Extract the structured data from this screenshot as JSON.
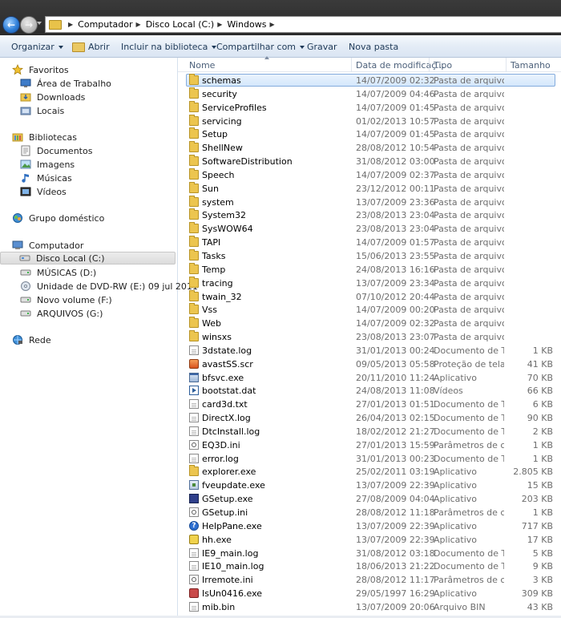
{
  "address": {
    "segments": [
      "Computador",
      "Disco Local (C:)",
      "Windows"
    ]
  },
  "toolbar": {
    "organize": "Organizar",
    "open": "Abrir",
    "include": "Incluir na biblioteca",
    "share": "Compartilhar com",
    "burn": "Gravar",
    "new_folder": "Nova pasta"
  },
  "nav": {
    "favorites": "Favoritos",
    "desktop": "Área de Trabalho",
    "downloads": "Downloads",
    "places": "Locais",
    "libraries": "Bibliotecas",
    "documents": "Documentos",
    "images": "Imagens",
    "music": "Músicas",
    "videos": "Vídeos",
    "homegroup": "Grupo doméstico",
    "computer": "Computador",
    "local_disk": "Disco Local (C:)",
    "music_drive": "MÚSICAS (D:)",
    "dvd": "Unidade de DVD-RW (E:) 09 jul 2011",
    "new_volume": "Novo volume (F:)",
    "archives": "ARQUIVOS (G:)",
    "network": "Rede"
  },
  "columns": {
    "name": "Nome",
    "date": "Data de modificaç...",
    "type": "Tipo",
    "size": "Tamanho"
  },
  "files": [
    {
      "name": "schemas",
      "date": "14/07/2009 02:32",
      "type": "Pasta de arquivos",
      "size": "",
      "icon": "folder-icon"
    },
    {
      "name": "security",
      "date": "14/07/2009 04:46",
      "type": "Pasta de arquivos",
      "size": "",
      "icon": "folder-icon"
    },
    {
      "name": "ServiceProfiles",
      "date": "14/07/2009 01:45",
      "type": "Pasta de arquivos",
      "size": "",
      "icon": "folder-icon"
    },
    {
      "name": "servicing",
      "date": "01/02/2013 10:57",
      "type": "Pasta de arquivos",
      "size": "",
      "icon": "folder-icon"
    },
    {
      "name": "Setup",
      "date": "14/07/2009 01:45",
      "type": "Pasta de arquivos",
      "size": "",
      "icon": "folder-icon"
    },
    {
      "name": "ShellNew",
      "date": "28/08/2012 10:54",
      "type": "Pasta de arquivos",
      "size": "",
      "icon": "folder-icon"
    },
    {
      "name": "SoftwareDistribution",
      "date": "31/08/2012 03:00",
      "type": "Pasta de arquivos",
      "size": "",
      "icon": "folder-icon"
    },
    {
      "name": "Speech",
      "date": "14/07/2009 02:37",
      "type": "Pasta de arquivos",
      "size": "",
      "icon": "folder-icon"
    },
    {
      "name": "Sun",
      "date": "23/12/2012 00:11",
      "type": "Pasta de arquivos",
      "size": "",
      "icon": "folder-icon"
    },
    {
      "name": "system",
      "date": "13/07/2009 23:36",
      "type": "Pasta de arquivos",
      "size": "",
      "icon": "folder-icon"
    },
    {
      "name": "System32",
      "date": "23/08/2013 23:04",
      "type": "Pasta de arquivos",
      "size": "",
      "icon": "folder-icon"
    },
    {
      "name": "SysWOW64",
      "date": "23/08/2013 23:04",
      "type": "Pasta de arquivos",
      "size": "",
      "icon": "folder-icon"
    },
    {
      "name": "TAPI",
      "date": "14/07/2009 01:57",
      "type": "Pasta de arquivos",
      "size": "",
      "icon": "folder-icon"
    },
    {
      "name": "Tasks",
      "date": "15/06/2013 23:55",
      "type": "Pasta de arquivos",
      "size": "",
      "icon": "folder-icon"
    },
    {
      "name": "Temp",
      "date": "24/08/2013 16:16",
      "type": "Pasta de arquivos",
      "size": "",
      "icon": "folder-icon"
    },
    {
      "name": "tracing",
      "date": "13/07/2009 23:34",
      "type": "Pasta de arquivos",
      "size": "",
      "icon": "folder-icon"
    },
    {
      "name": "twain_32",
      "date": "07/10/2012 20:44",
      "type": "Pasta de arquivos",
      "size": "",
      "icon": "folder-icon"
    },
    {
      "name": "Vss",
      "date": "14/07/2009 00:20",
      "type": "Pasta de arquivos",
      "size": "",
      "icon": "folder-icon"
    },
    {
      "name": "Web",
      "date": "14/07/2009 02:32",
      "type": "Pasta de arquivos",
      "size": "",
      "icon": "folder-icon"
    },
    {
      "name": "winsxs",
      "date": "23/08/2013 23:07",
      "type": "Pasta de arquivos",
      "size": "",
      "icon": "folder-icon"
    },
    {
      "name": "3dstate.log",
      "date": "31/01/2013 00:24",
      "type": "Documento de Te...",
      "size": "1 KB",
      "icon": "text-file-icon"
    },
    {
      "name": "avastSS.scr",
      "date": "09/05/2013 05:58",
      "type": "Proteção de tela",
      "size": "41 KB",
      "icon": "screensaver-icon"
    },
    {
      "name": "bfsvc.exe",
      "date": "20/11/2010 11:24",
      "type": "Aplicativo",
      "size": "70 KB",
      "icon": "application-icon"
    },
    {
      "name": "bootstat.dat",
      "date": "24/08/2013 11:08",
      "type": "Vídeos",
      "size": "66 KB",
      "icon": "video-file-icon"
    },
    {
      "name": "card3d.txt",
      "date": "27/01/2013 01:51",
      "type": "Documento de Te...",
      "size": "6 KB",
      "icon": "text-file-icon"
    },
    {
      "name": "DirectX.log",
      "date": "26/04/2013 02:15",
      "type": "Documento de Te...",
      "size": "90 KB",
      "icon": "text-file-icon"
    },
    {
      "name": "DtcInstall.log",
      "date": "18/02/2012 21:27",
      "type": "Documento de Te...",
      "size": "2 KB",
      "icon": "text-file-icon"
    },
    {
      "name": "EQ3D.ini",
      "date": "27/01/2013 15:59",
      "type": "Parâmetros de co...",
      "size": "1 KB",
      "icon": "config-file-icon"
    },
    {
      "name": "error.log",
      "date": "31/01/2013 00:23",
      "type": "Documento de Te...",
      "size": "1 KB",
      "icon": "text-file-icon"
    },
    {
      "name": "explorer.exe",
      "date": "25/02/2011 03:19",
      "type": "Aplicativo",
      "size": "2.805 KB",
      "icon": "folder-icon"
    },
    {
      "name": "fveupdate.exe",
      "date": "13/07/2009 22:39",
      "type": "Aplicativo",
      "size": "15 KB",
      "icon": "bitlocker-app-icon"
    },
    {
      "name": "GSetup.exe",
      "date": "27/08/2009 04:04",
      "type": "Aplicativo",
      "size": "203 KB",
      "icon": "setup-app-icon"
    },
    {
      "name": "GSetup.ini",
      "date": "28/08/2012 11:18",
      "type": "Parâmetros de co...",
      "size": "1 KB",
      "icon": "config-file-icon"
    },
    {
      "name": "HelpPane.exe",
      "date": "13/07/2009 22:39",
      "type": "Aplicativo",
      "size": "717 KB",
      "icon": "help-icon"
    },
    {
      "name": "hh.exe",
      "date": "13/07/2009 22:39",
      "type": "Aplicativo",
      "size": "17 KB",
      "icon": "help-book-icon"
    },
    {
      "name": "IE9_main.log",
      "date": "31/08/2012 03:18",
      "type": "Documento de Te...",
      "size": "5 KB",
      "icon": "text-file-icon"
    },
    {
      "name": "IE10_main.log",
      "date": "18/06/2013 21:22",
      "type": "Documento de Te...",
      "size": "9 KB",
      "icon": "text-file-icon"
    },
    {
      "name": "Irremote.ini",
      "date": "28/08/2012 11:17",
      "type": "Parâmetros de co...",
      "size": "3 KB",
      "icon": "config-file-icon"
    },
    {
      "name": "IsUn0416.exe",
      "date": "29/05/1997 16:29",
      "type": "Aplicativo",
      "size": "309 KB",
      "icon": "uninstaller-icon"
    },
    {
      "name": "mib.bin",
      "date": "13/07/2009 20:06",
      "type": "Arquivo BIN",
      "size": "43 KB",
      "icon": "text-file-icon"
    }
  ],
  "selected_file_index": 0
}
